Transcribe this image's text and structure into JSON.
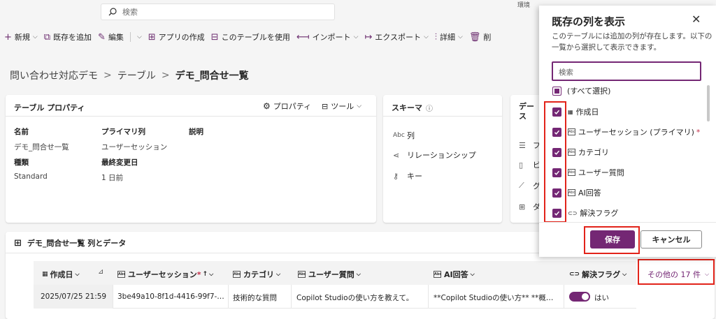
{
  "top": {
    "search_placeholder": "検索",
    "env_fragment": "環境"
  },
  "toolbar": [
    {
      "icon": "plus-icon",
      "label": "新規",
      "chev": true
    },
    {
      "icon": "add-existing-icon",
      "label": "既存を追加",
      "chev": false
    },
    {
      "icon": "edit-icon",
      "label": "編集",
      "chev": true
    },
    {
      "icon": "app-icon",
      "label": "アプリの作成",
      "chev": false
    },
    {
      "icon": "table-icon",
      "label": "このテーブルを使用",
      "chev": false
    },
    {
      "icon": "import-icon",
      "label": "インポート",
      "chev": true
    },
    {
      "icon": "export-icon",
      "label": "エクスポート",
      "chev": true
    },
    {
      "icon": "settings-icon",
      "label": "詳細",
      "chev": true
    },
    {
      "icon": "delete-icon",
      "label": "削",
      "chev": false
    }
  ],
  "breadcrumb": {
    "root": "問い合わせ対応デモ",
    "mid": "テーブル",
    "current": "デモ_問合せ一覧",
    "sep": ">"
  },
  "properties_card": {
    "title": "テーブル プロパティ",
    "properties_btn": "プロパティ",
    "tools_btn": "ツール",
    "name_label": "名前",
    "name_value": "デモ_問合せ一覧",
    "primary_label": "プライマリ列",
    "primary_value": "ユーザーセッション",
    "desc_label": "説明",
    "type_label": "種類",
    "type_value": "Standard",
    "modified_label": "最終変更日",
    "modified_value": "1 日前"
  },
  "schema_card": {
    "title": "スキーマ",
    "items": [
      "列",
      "リレーションシップ",
      "キー"
    ]
  },
  "data_card": {
    "title_line1": "デー",
    "title_line2": "ス",
    "items": [
      "フ",
      "ビ",
      "グ",
      "ダ"
    ]
  },
  "grid": {
    "title": "デモ_問合せ一覧 列とデータ",
    "columns": [
      "作成日",
      "ユーザーセッション",
      "カテゴリ",
      "ユーザー質問",
      "AI回答",
      "解決フラグ"
    ],
    "more_columns": "その他の 17 件",
    "row": {
      "created": "2025/07/25 21:59",
      "session": "3be49a10-8f1d-4416-99f7-…",
      "category": "技術的な質問",
      "question": "Copilot Studioの使い方を教えて。",
      "answer": "**Copilot Studioの使い方**  **概…",
      "resolved": "はい"
    }
  },
  "panel": {
    "title": "既存の列を表示",
    "description": "このテーブルには追加の列が存在します。以下の一覧から選択して表示できます。",
    "search_placeholder": "検索",
    "select_all": "(すべて選択)",
    "items": [
      {
        "label": "作成日",
        "icon": "calendar-icon",
        "required": ""
      },
      {
        "label": "ユーザーセッション (プライマリ)",
        "icon": "text-field-icon",
        "required": "*"
      },
      {
        "label": "カテゴリ",
        "icon": "text-field-icon",
        "required": ""
      },
      {
        "label": "ユーザー質問",
        "icon": "multiline-text-icon",
        "required": ""
      },
      {
        "label": "AI回答",
        "icon": "multiline-text-icon",
        "required": ""
      },
      {
        "label": "解決フラグ",
        "icon": "toggle-icon",
        "required": ""
      }
    ],
    "save": "保存",
    "cancel": "キャンセル"
  },
  "colors": {
    "accent": "#742774",
    "highlight": "#e2231a",
    "link": "#742774"
  }
}
